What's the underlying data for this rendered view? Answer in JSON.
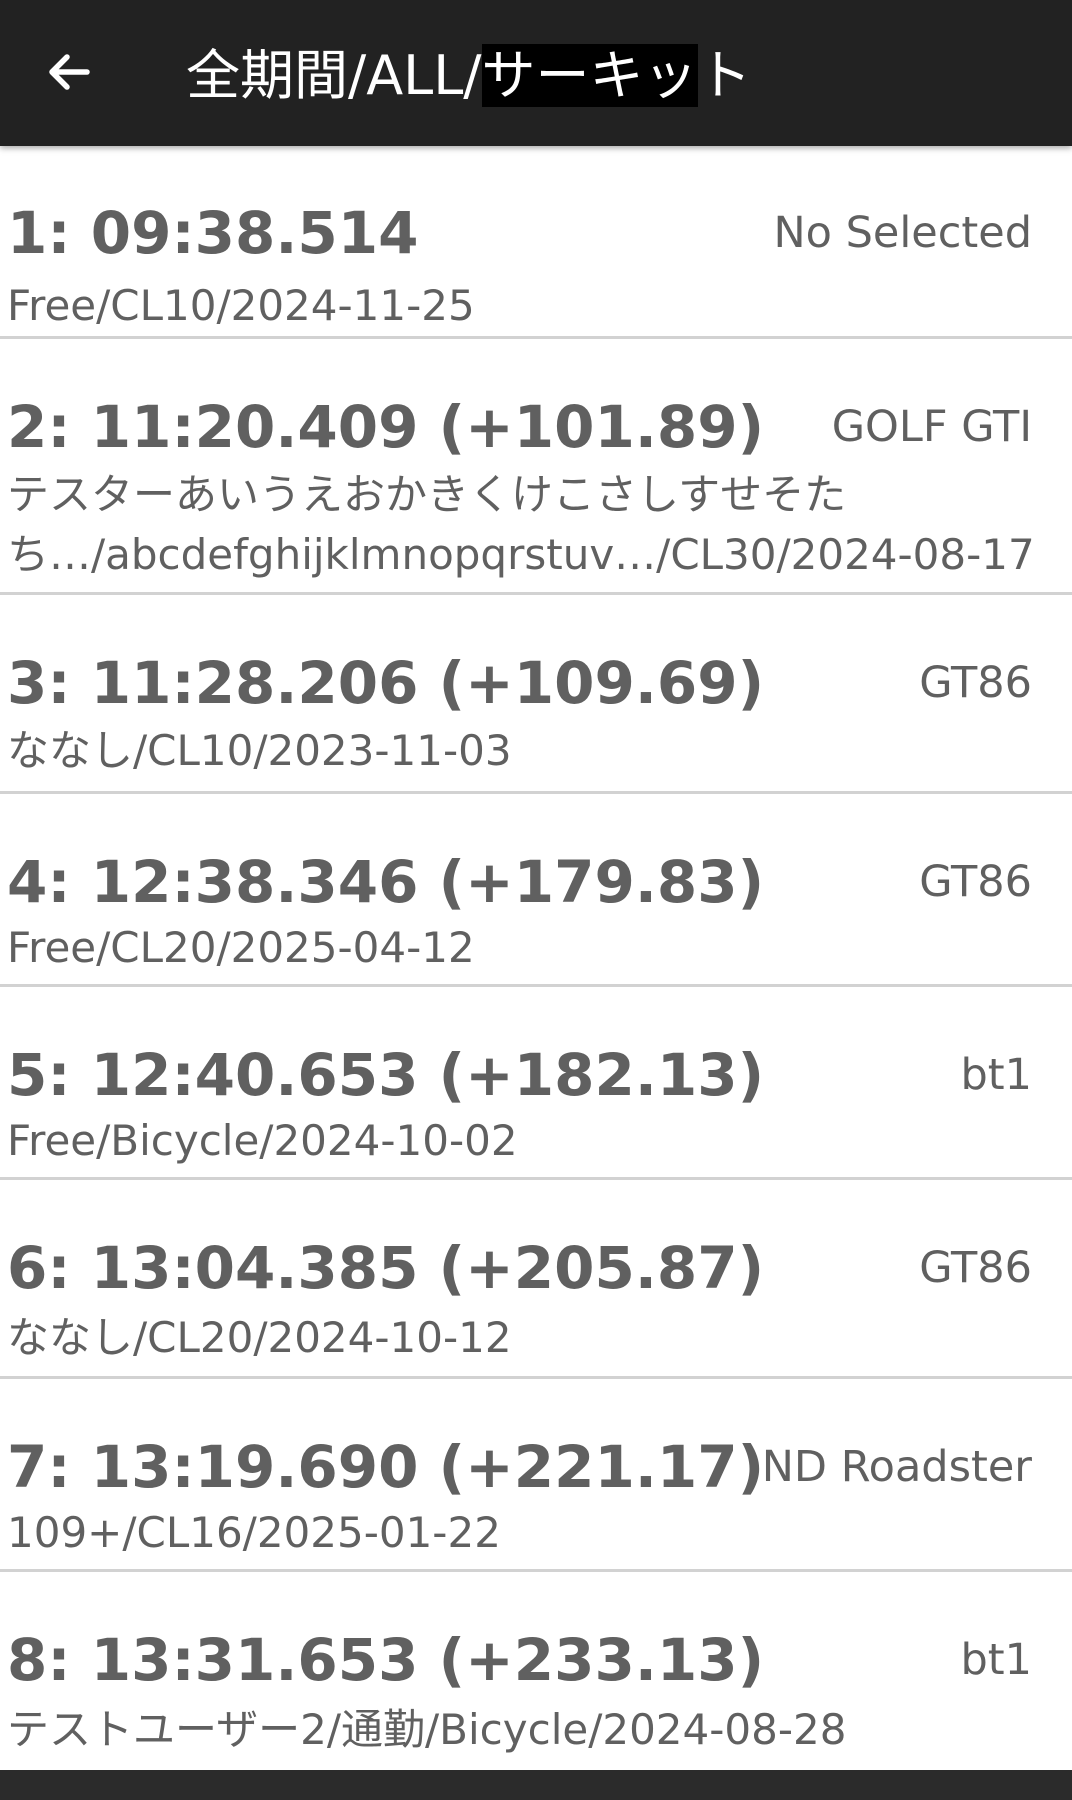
{
  "header": {
    "title_prefix": "全期間/ALL/",
    "title_highlight": "サーキッ",
    "title_suffix": "ト"
  },
  "records": [
    {
      "time": "1: 09:38.514",
      "car": "No Selected",
      "detail": "Free/CL10/2024-11-25"
    },
    {
      "time": "2: 11:20.409 (+101.89)",
      "car": "GOLF GTI",
      "detail": "テスターあいうえおかきくけこさしすせそたち…/abcdefghijklmnopqrstuv…/CL30/2024-08-17"
    },
    {
      "time": "3: 11:28.206 (+109.69)",
      "car": "GT86",
      "detail": "ななし/CL10/2023-11-03"
    },
    {
      "time": "4: 12:38.346 (+179.83)",
      "car": "GT86",
      "detail": "Free/CL20/2025-04-12"
    },
    {
      "time": "5: 12:40.653 (+182.13)",
      "car": "bt1",
      "detail": "Free/Bicycle/2024-10-02"
    },
    {
      "time": "6: 13:04.385 (+205.87)",
      "car": "GT86",
      "detail": "ななし/CL20/2024-10-12"
    },
    {
      "time": "7: 13:19.690 (+221.17)",
      "car": "ND Roadster",
      "detail": "109+/CL16/2025-01-22"
    },
    {
      "time": "8: 13:31.653 (+233.13)",
      "car": "bt1",
      "detail": "テストユーザー2/通勤/Bicycle/2024-08-28"
    }
  ]
}
